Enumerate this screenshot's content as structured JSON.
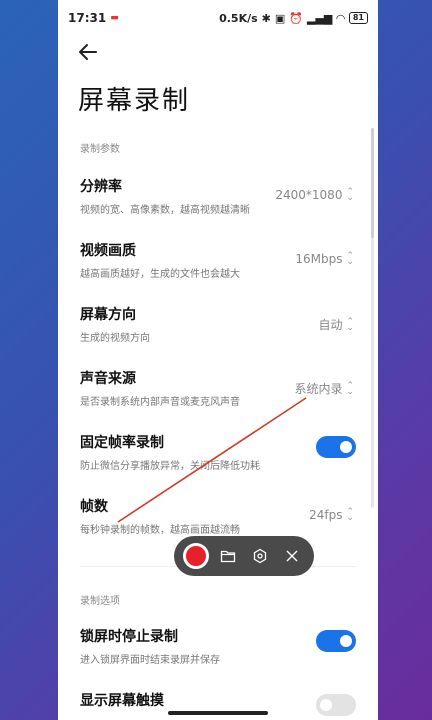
{
  "status_bar": {
    "time": "17:31",
    "network_speed": "0.5K/s",
    "battery": "81"
  },
  "page": {
    "title": "屏幕录制"
  },
  "sections": {
    "params_label": "录制参数",
    "options_label": "录制选项"
  },
  "settings": [
    {
      "label": "分辨率",
      "desc": "视频的宽、高像素数，越高视频越清晰",
      "value": "2400*1080"
    },
    {
      "label": "视频画质",
      "desc": "越高画质越好，生成的文件也会越大",
      "value": "16Mbps"
    },
    {
      "label": "屏幕方向",
      "desc": "生成的视频方向",
      "value": "自动"
    },
    {
      "label": "声音来源",
      "desc": "是否录制系统内部声音或麦克风声音",
      "value": "系统内录"
    },
    {
      "label": "固定帧率录制",
      "desc": "防止微信分享播放异常，关闭后降低功耗"
    },
    {
      "label": "帧数",
      "desc": "每秒钟录制的帧数，越高画面越流畅",
      "value": "24fps"
    }
  ],
  "options": [
    {
      "label": "锁屏时停止录制",
      "desc": "进入锁屏界面时结束录屏并保存"
    },
    {
      "label": "显示屏幕触摸"
    }
  ],
  "toggles": {
    "fixed_framerate": "on",
    "stop_on_lock": "on",
    "show_touches": "off"
  },
  "colors": {
    "accent": "#1a73e8",
    "record": "#e8202a",
    "annotation": "#d23a2a"
  }
}
